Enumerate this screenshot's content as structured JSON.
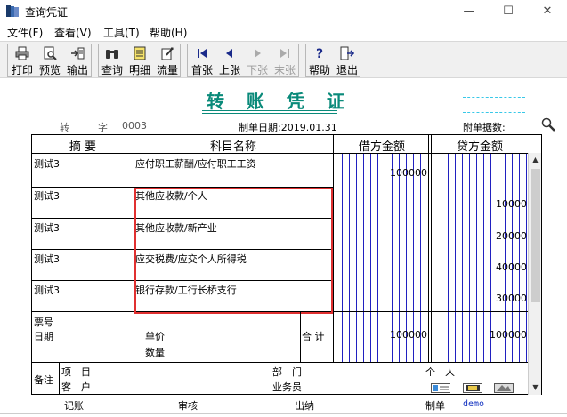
{
  "window": {
    "title": "查询凭证",
    "min": "—",
    "max": "☐",
    "close": "✕"
  },
  "menu": [
    {
      "label": "文件(F)"
    },
    {
      "label": "查看(V)"
    },
    {
      "label": "工具(T)"
    },
    {
      "label": "帮助(H)"
    }
  ],
  "toolbar": {
    "print": "打印",
    "preview": "预览",
    "export": "输出",
    "query": "查询",
    "detail": "明细",
    "flow": "流量",
    "first": "首张",
    "prev": "上张",
    "next": "下张",
    "last": "末张",
    "help": "帮助",
    "exit": "退出"
  },
  "voucher": {
    "title": "转 账 凭 证",
    "type": "转",
    "zi": "字",
    "number": "0003",
    "date_label": "制单日期:",
    "date": "2019.01.31",
    "attach_label": "附单据数:"
  },
  "table": {
    "headers": {
      "summary": "摘 要",
      "account": "科目名称",
      "debit": "借方金额",
      "credit": "贷方金额"
    },
    "rows": [
      {
        "summary": "测试3",
        "account": "应付职工薪酬/应付职工工资",
        "debit": "100000",
        "credit": ""
      },
      {
        "summary": "测试3",
        "account": "其他应收款/个人",
        "debit": "",
        "credit": "10000"
      },
      {
        "summary": "测试3",
        "account": "其他应收款/新产业",
        "debit": "",
        "credit": "20000"
      },
      {
        "summary": "测试3",
        "account": "应交税费/应交个人所得税",
        "debit": "",
        "credit": "40000"
      },
      {
        "summary": "测试3",
        "account": "银行存款/工行长桥支行",
        "debit": "",
        "credit": "30000"
      }
    ],
    "ticket_label": "票号",
    "date_label": "日期",
    "price_label": "单价",
    "qty_label": "数量",
    "total_label": "合 计",
    "total_debit": "100000",
    "total_credit": "100000",
    "notes_label": "备注",
    "project_label": "项　目",
    "customer_label": "客　户",
    "dept_label": "部　门",
    "salesman_label": "业务员",
    "person_label": "个　人"
  },
  "footer": {
    "bookkeeping": "记账",
    "review": "审核",
    "cashier": "出纳",
    "maker": "制单",
    "maker_name": "demo"
  },
  "colors": {
    "title": "#0a8a7a",
    "highlight": "#e03030",
    "blue_grid": "#2020c0",
    "maker_name": "#1030c0"
  }
}
